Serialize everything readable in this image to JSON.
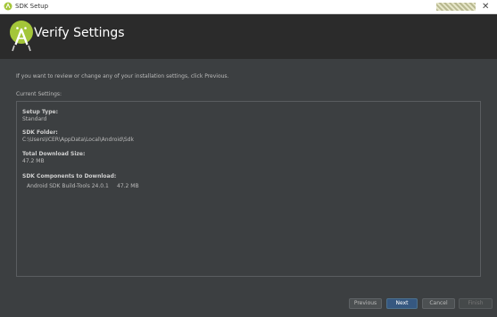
{
  "window": {
    "title": "SDK Setup",
    "close_glyph": "✕"
  },
  "header": {
    "title": "Verify Settings",
    "logo_icon": "android-studio-icon"
  },
  "intro_text": "If you want to review or change any of your installation settings, click Previous.",
  "current_settings_label": "Current Settings:",
  "settings": {
    "setup_type_label": "Setup Type:",
    "setup_type_value": "Standard",
    "sdk_folder_label": "SDK Folder:",
    "sdk_folder_value": "C:\\Users\\ICER\\AppData\\Local\\Android\\Sdk",
    "download_size_label": "Total Download Size:",
    "download_size_value": "47.2 MB",
    "components_label": "SDK Components to Download:",
    "components": [
      {
        "name": "Android SDK Build-Tools 24.0.1",
        "size": "47.2 MB"
      }
    ]
  },
  "buttons": {
    "previous": "Previous",
    "next": "Next",
    "cancel": "Cancel",
    "finish": "Finish"
  },
  "colors": {
    "background": "#3c3f41",
    "banner": "#2b2b2b",
    "accent": "#365880",
    "android_green": "#a4c639"
  }
}
